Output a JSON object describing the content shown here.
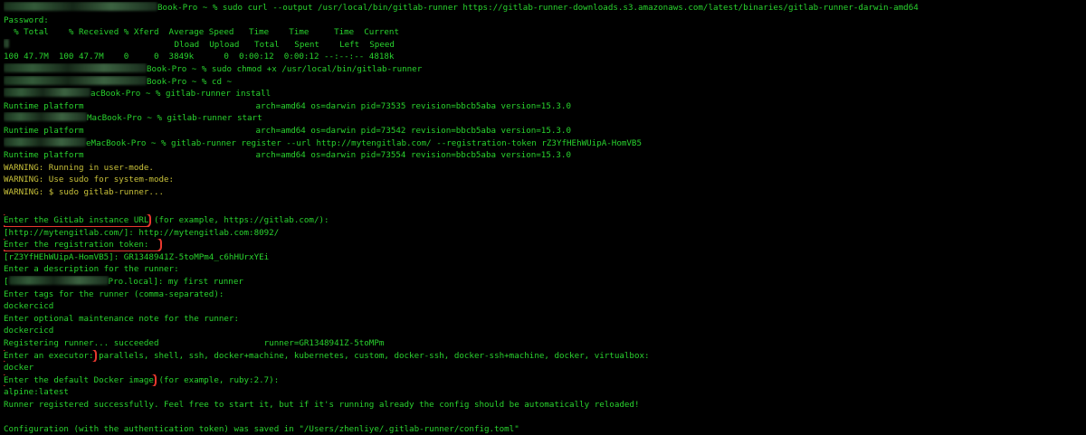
{
  "colors": {
    "background": "#000000",
    "text": "#29d32e",
    "warning": "#c9c23a",
    "highlight_box": "#e8382e"
  },
  "terminal": {
    "prompt_suffix": "Book-Pro ~ %",
    "lines": {
      "cmd_curl": " sudo curl --output /usr/local/bin/gitlab-runner https://gitlab-runner-downloads.s3.amazonaws.com/latest/binaries/gitlab-runner-darwin-amd64",
      "password": "Password:",
      "curl_head1": "  % Total    % Received % Xferd  Average Speed   Time    Time     Time  Current",
      "curl_head2": "                                 Dload  Upload   Total   Spent    Left  Speed",
      "curl_progress": "100 47.7M  100 47.7M    0     0  3849k      0  0:00:12  0:00:12 --:--:-- 4818k",
      "prompt_chmod": "Book-Pro ~ %",
      "cmd_chmod": " sudo chmod +x /usr/local/bin/gitlab-runner",
      "prompt_cd": "Book-Pro ~ %",
      "cmd_cd": " cd ~",
      "prompt_install": "acBook-Pro ~ %",
      "cmd_install": " gitlab-runner install",
      "runtime_label": "Runtime platform",
      "runtime_install": "arch=amd64 os=darwin pid=73535 revision=bbcb5aba version=15.3.0",
      "prompt_start": "MacBook-Pro ~ %",
      "cmd_start": " gitlab-runner start",
      "runtime_start": "arch=amd64 os=darwin pid=73542 revision=bbcb5aba version=15.3.0",
      "prompt_register": "eMacBook-Pro ~ %",
      "cmd_register": " gitlab-runner register --url http://mytengitlab.com/ --registration-token rZ3YfHEhWUipA-HomVB5",
      "runtime_register": "arch=amd64 os=darwin pid=73554 revision=bbcb5aba version=15.3.0",
      "warn1": "WARNING: Running in user-mode.",
      "warn2": "WARNING: Use sudo for system-mode:",
      "warn3": "WARNING: $ sudo gitlab-runner...",
      "url_prompt": "Enter the GitLab instance URL",
      "url_example": " (for example, https://gitlab.com/):",
      "url_answer": "[http://mytengitlab.com/]: http://mytengitlab.com:8092/",
      "token_prompt": "Enter the registration token:",
      "token_answer": "[rZ3YfHEhWUipA-HomVB5]: GR1348941Z-5toMPm4_c6hHUrxYEi",
      "desc_prompt": "Enter a description for the runner:",
      "desc_answer": "Pro.local]: my first runner",
      "tags_prompt": "Enter tags for the runner (comma-separated):",
      "tags_answer": "dockercicd",
      "note_prompt": "Enter optional maintenance note for the runner:",
      "note_answer": "dockercicd",
      "registering": "Registering runner... succeeded                     runner=GR1348941Z-5toMPm",
      "executor_prompt": "Enter an executor:",
      "executor_options": " parallels, shell, ssh, docker+machine, kubernetes, custom, docker-ssh, docker-ssh+machine, docker, virtualbox:",
      "executor_answer": "docker",
      "image_prompt": "Enter the default Docker image",
      "image_example": " (for example, ruby:2.7):",
      "image_answer": "alpine:latest",
      "success": "Runner registered successfully. Feel free to start it, but if it's running already the config should be automatically reloaded!",
      "config_saved": "Configuration (with the authentication token) was saved in \"/Users/zhenliye/.gitlab-runner/config.toml\""
    }
  }
}
